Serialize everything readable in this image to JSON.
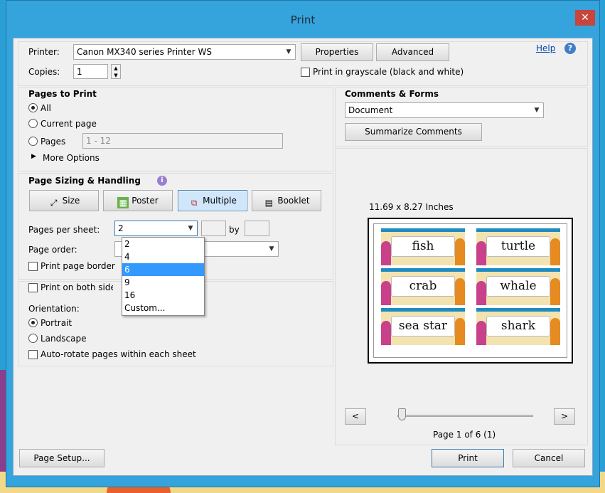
{
  "window": {
    "title": "Print",
    "close": "✕"
  },
  "printer": {
    "label": "Printer:",
    "value": "Canon MX340 series Printer WS",
    "properties": "Properties",
    "advanced": "Advanced",
    "help": "Help",
    "help_icon": "?"
  },
  "copies": {
    "label": "Copies:",
    "value": "1"
  },
  "grayscale": {
    "label": "Print in grayscale (black and white)"
  },
  "pages_to_print": {
    "title": "Pages to Print",
    "all": "All",
    "current": "Current page",
    "pages": "Pages",
    "pages_value": "1 - 12",
    "more": "More Options"
  },
  "sizing": {
    "title": "Page Sizing & Handling",
    "info_icon": "i",
    "size": "Size",
    "poster": "Poster",
    "multiple": "Multiple",
    "booklet": "Booklet",
    "pages_per_sheet_label": "Pages per sheet:",
    "pages_per_sheet_value": "2",
    "by": "by",
    "page_order_label": "Page order:",
    "print_border": "Print page border",
    "dropdown_options": [
      "2",
      "4",
      "6",
      "9",
      "16",
      "Custom..."
    ],
    "dropdown_selected": "6"
  },
  "duplex": {
    "label": "Print on both sides of paper"
  },
  "orientation": {
    "label": "Orientation:",
    "portrait": "Portrait",
    "landscape": "Landscape",
    "autorotate": "Auto-rotate pages within each sheet"
  },
  "comments": {
    "title": "Comments & Forms",
    "value": "Document",
    "summarize": "Summarize Comments"
  },
  "preview": {
    "size_text": "11.69 x 8.27 Inches",
    "cards": [
      "fish",
      "turtle",
      "crab",
      "whale",
      "sea star",
      "shark"
    ],
    "prev": "<",
    "next": ">",
    "page_text": "Page 1 of 6 (1)"
  },
  "footer": {
    "page_setup": "Page Setup...",
    "print": "Print",
    "cancel": "Cancel"
  },
  "colors": {
    "accent": "#35a3dc",
    "selection": "#3399ff",
    "close": "#c7453b"
  }
}
